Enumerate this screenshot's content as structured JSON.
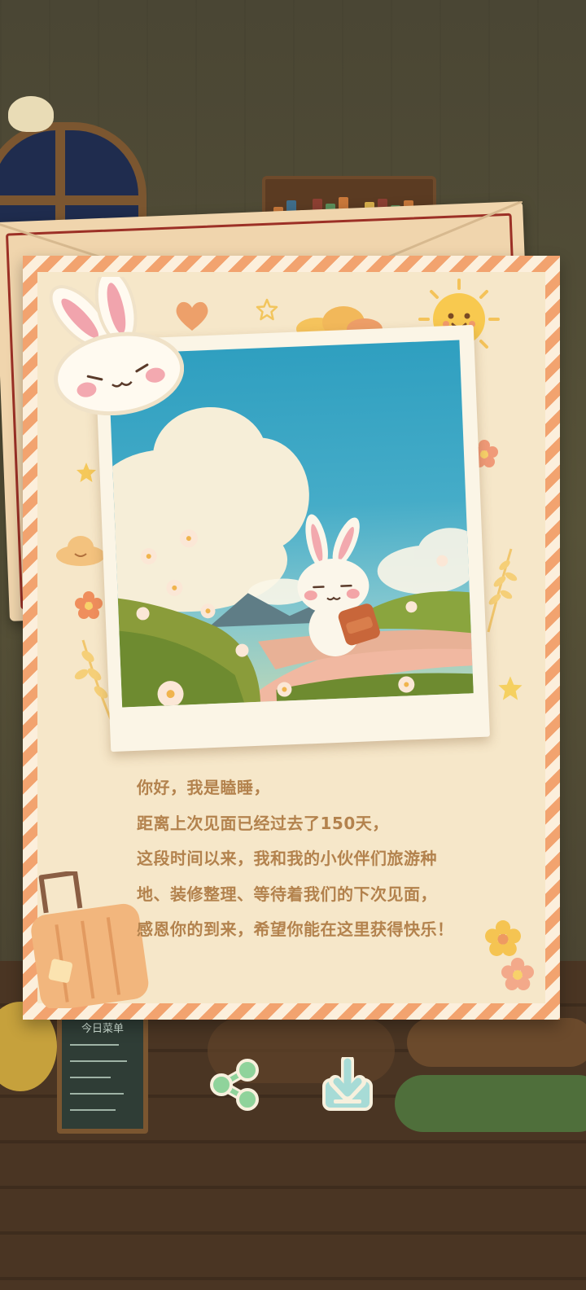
{
  "letter": {
    "lines": [
      "你好，我是瞌睡，",
      "距离上次见面已经过去了150天，",
      "这段时间以来，我和我的小伙伴们旅游种",
      "地、装修整理、等待着我们的下次见面，",
      "感恩你的到来，希望你能在这里获得快乐！"
    ]
  },
  "board": {
    "title": "今日菜单"
  },
  "actions": {
    "share": {
      "icon": "share-icon",
      "color": "#8fd39b"
    },
    "download": {
      "icon": "download-icon",
      "color": "#a7dbd6"
    }
  },
  "colors": {
    "text": "#b3824d",
    "letter_paper": "#f6e7c9",
    "stripe": "#f2a36f"
  }
}
